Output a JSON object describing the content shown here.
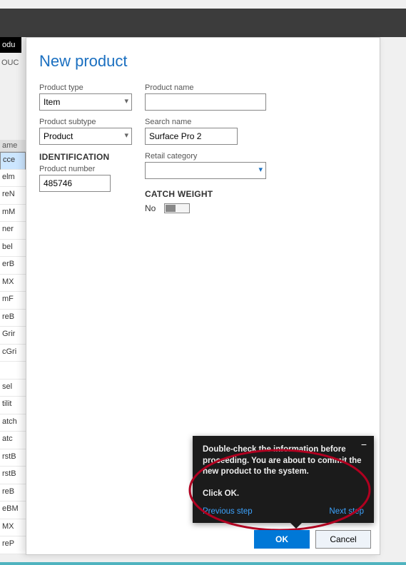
{
  "window": {
    "black_tab": "odu",
    "ouc_label": "OUC"
  },
  "bg_list": {
    "header": "ame",
    "rows": [
      "cce",
      "elm",
      "reN",
      "mM",
      "ner",
      "bel",
      "erB",
      "MX",
      "mF",
      "reB",
      "Grir",
      "cGri",
      "",
      "sel",
      "tilit",
      "atch",
      "atc",
      "rstB",
      "rstB",
      "reB",
      "eBM",
      "MX",
      "reP"
    ]
  },
  "dialog": {
    "title": "New product",
    "fields": {
      "product_type_label": "Product type",
      "product_type_value": "Item",
      "product_subtype_label": "Product subtype",
      "product_subtype_value": "Product",
      "product_name_label": "Product name",
      "product_name_value": "",
      "search_name_label": "Search name",
      "search_name_value": "Surface Pro 2",
      "retail_category_label": "Retail category",
      "retail_category_value": "",
      "identification_header": "IDENTIFICATION",
      "product_number_label": "Product number",
      "product_number_value": "485746",
      "catch_weight_header": "CATCH WEIGHT",
      "catch_weight_value": "No"
    },
    "buttons": {
      "ok": "OK",
      "cancel": "Cancel"
    }
  },
  "tooltip": {
    "line1": "Double-check the information before proceeding. You are about to commit the new product to the system.",
    "line2": "Click OK.",
    "prev": "Previous step",
    "next": "Next step"
  }
}
